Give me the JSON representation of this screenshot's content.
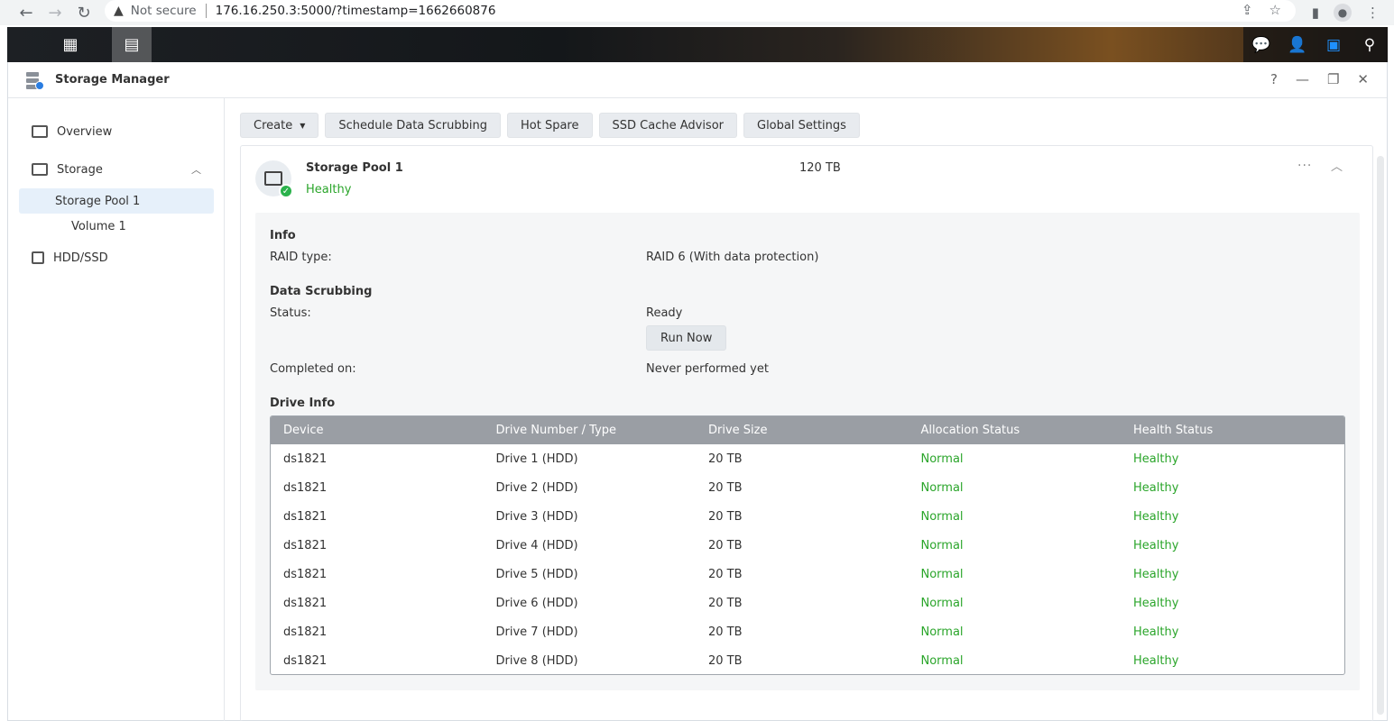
{
  "browser": {
    "security_label": "Not secure",
    "url": "176.16.250.3:5000/?timestamp=1662660876"
  },
  "window": {
    "title": "Storage Manager",
    "help": "?",
    "minimize": "—",
    "restore": "❐",
    "close": "✕"
  },
  "sidebar": {
    "overview": "Overview",
    "storage": "Storage",
    "storage_pool": "Storage Pool 1",
    "volume": "Volume 1",
    "hdd": "HDD/SSD"
  },
  "toolbar": {
    "create": "Create",
    "schedule": "Schedule Data Scrubbing",
    "hot_spare": "Hot Spare",
    "ssd_cache": "SSD Cache Advisor",
    "global": "Global Settings"
  },
  "pool": {
    "name": "Storage Pool 1",
    "status": "Healthy",
    "size": "120 TB",
    "more": "···"
  },
  "info": {
    "title": "Info",
    "raid_label": "RAID type:",
    "raid_value": "RAID 6 (With data protection)"
  },
  "scrubbing": {
    "title": "Data Scrubbing",
    "status_label": "Status:",
    "status_value": "Ready",
    "run_now": "Run Now",
    "completed_label": "Completed on:",
    "completed_value": "Never performed yet"
  },
  "drive_info": {
    "title": "Drive Info",
    "columns": [
      "Device",
      "Drive Number / Type",
      "Drive Size",
      "Allocation Status",
      "Health Status"
    ],
    "rows": [
      [
        "ds1821",
        "Drive 1 (HDD)",
        "20 TB",
        "Normal",
        "Healthy"
      ],
      [
        "ds1821",
        "Drive 2 (HDD)",
        "20 TB",
        "Normal",
        "Healthy"
      ],
      [
        "ds1821",
        "Drive 3 (HDD)",
        "20 TB",
        "Normal",
        "Healthy"
      ],
      [
        "ds1821",
        "Drive 4 (HDD)",
        "20 TB",
        "Normal",
        "Healthy"
      ],
      [
        "ds1821",
        "Drive 5 (HDD)",
        "20 TB",
        "Normal",
        "Healthy"
      ],
      [
        "ds1821",
        "Drive 6 (HDD)",
        "20 TB",
        "Normal",
        "Healthy"
      ],
      [
        "ds1821",
        "Drive 7 (HDD)",
        "20 TB",
        "Normal",
        "Healthy"
      ],
      [
        "ds1821",
        "Drive 8 (HDD)",
        "20 TB",
        "Normal",
        "Healthy"
      ]
    ]
  },
  "colors": {
    "healthy_green": "#2aa52a",
    "table_header": "#9a9ea4",
    "selected_bg": "#e6f0fa"
  }
}
